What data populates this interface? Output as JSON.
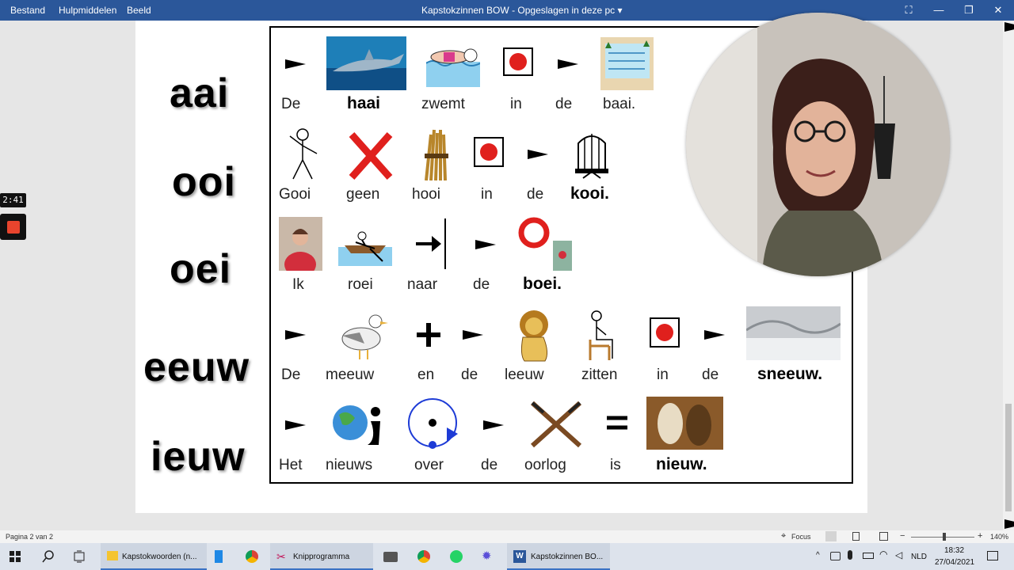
{
  "titlebar": {
    "menu": [
      "Bestand",
      "Hulpmiddelen",
      "Beeld"
    ],
    "title": "Kapstokzinnen BOW",
    "save_state": "Opgeslagen in deze pc",
    "caret": "▾",
    "btn_fit": "⛶",
    "btn_min": "—",
    "btn_max": "❐",
    "btn_close": "✕"
  },
  "recorder": {
    "time": "2:41"
  },
  "sounds": [
    "aai",
    "ooi",
    "oei",
    "eeuw",
    "ieuw"
  ],
  "sentences": [
    {
      "words": [
        "De",
        "haai",
        "zwemt",
        "in",
        "de",
        "baai."
      ]
    },
    {
      "words": [
        "Gooi",
        "geen",
        "hooi",
        "in",
        "de",
        "kooi."
      ]
    },
    {
      "words": [
        "Ik",
        "roei",
        "naar",
        "de",
        "boei."
      ]
    },
    {
      "words": [
        "De",
        "meeuw",
        "en",
        "de",
        "leeuw",
        "zitten",
        "in",
        "de",
        "sneeuw."
      ]
    },
    {
      "words": [
        "Het",
        "nieuws",
        "over",
        "de",
        "oorlog",
        "is",
        "nieuw."
      ]
    }
  ],
  "statusbar": {
    "page": "Pagina 2 van 2",
    "focus": "Focus",
    "zoom": "140%"
  },
  "taskbar": {
    "apps": [
      {
        "label": "Kapstokwoorden (n...",
        "icon": "folder-icon"
      },
      {
        "label": "Knipprogramma",
        "icon": "snipping-icon"
      },
      {
        "label": "Kapstokzinnen BO...",
        "icon": "word-icon"
      }
    ],
    "lang": "NLD",
    "time": "18:32",
    "date": "27/04/2021"
  },
  "colors": {
    "titlebar": "#2b579a",
    "accent_red": "#e0201d",
    "record": "#e8442d"
  }
}
